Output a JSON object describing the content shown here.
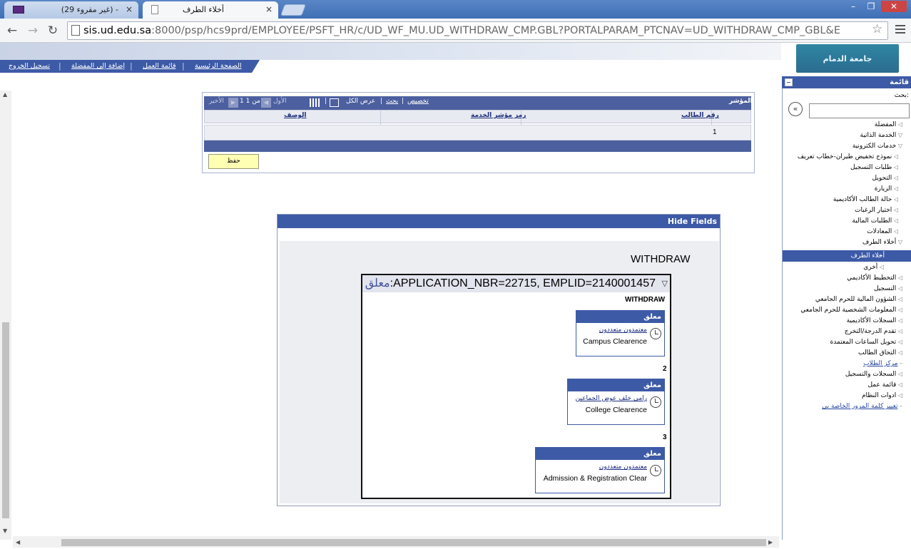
{
  "browser": {
    "tabs": [
      {
        "label": "(29 غير مقروء) -",
        "close": "×"
      },
      {
        "label": "أخلاء الطرف",
        "close": "×"
      }
    ],
    "url_domain": "sis.ud.edu.sa",
    "url_rest": ":8000/psp/hcs9prd/EMPLOYEE/PSFT_HR/c/UD_WF_MU.UD_WITHDRAW_CMP.GBL?PORTALPARAM_PTCNAV=UD_WITHDRAW_CMP_GBL&E",
    "window_buttons": [
      "–",
      "❐",
      "✕"
    ]
  },
  "header": {
    "links": [
      "الصفحة الرئيسية",
      "قائمة العمل",
      "إضافة إلى المفضلة",
      "تسجيل الخروج"
    ],
    "logo_text": "جامعة الدمام"
  },
  "menu": {
    "title": "قائمة",
    "search_label": "بحث:",
    "go": "«",
    "items": [
      {
        "label": "المفضلة",
        "type": "closed"
      },
      {
        "label": "الخدمة الذاتية",
        "type": "open"
      },
      {
        "label": "خدمات الكترونية",
        "type": "open"
      },
      {
        "label": "نموذج تخفيض طيران-خطاب تعريف",
        "type": "closed"
      },
      {
        "label": "طلبات التسجيل",
        "type": "closed"
      },
      {
        "label": "التحويل",
        "type": "closed"
      },
      {
        "label": "الزيارة",
        "type": "closed"
      },
      {
        "label": "حالة الطالب الأكاديمية",
        "type": "closed"
      },
      {
        "label": "اختيار الرغبات",
        "type": "closed"
      },
      {
        "label": "الطلبات المالية",
        "type": "closed"
      },
      {
        "label": "المعادلات",
        "type": "closed"
      },
      {
        "label": "أخلاء الطرف",
        "type": "open"
      },
      {
        "label": "أخلاء الطرف",
        "type": "selected"
      },
      {
        "label": "أخرى",
        "type": "closed"
      },
      {
        "label": "التخطيط الأكاديمي",
        "type": "closed"
      },
      {
        "label": "التسجيل",
        "type": "closed"
      },
      {
        "label": "الشؤون المالية للحرم الجامعي",
        "type": "closed"
      },
      {
        "label": "المعلومات الشخصية للحرم الجامعي",
        "type": "closed"
      },
      {
        "label": "السجلات الأكاديمية",
        "type": "closed"
      },
      {
        "label": "تقدم الدرجة/التخرج",
        "type": "closed"
      },
      {
        "label": "تحويل الساعات المعتمدة",
        "type": "closed"
      },
      {
        "label": "التحاق الطالب",
        "type": "closed"
      },
      {
        "label": "مركز الطلاب",
        "type": "link"
      },
      {
        "label": "السجلات والتسجيل",
        "type": "closed"
      },
      {
        "label": "قائمة عمل",
        "type": "closed"
      },
      {
        "label": "ادوات النظام",
        "type": "closed"
      },
      {
        "label": "تغيير كلمة المرور الخاصة بي",
        "type": "link"
      }
    ]
  },
  "grid": {
    "title": "المؤشر",
    "toolbar": [
      "تخصيص",
      "بحث",
      "عرض الكل"
    ],
    "pager": {
      "first": "الأول",
      "count": "1 من 1",
      "last": "الأخير"
    },
    "columns": [
      "رقم الطالب",
      "رمز مؤشر الخدمة",
      "الوصف"
    ],
    "rows": [
      {
        "num": "1",
        "student": "",
        "code": "",
        "desc": ""
      }
    ],
    "save_label": "حفظ"
  },
  "workflow": {
    "hide_label": "Hide Fields",
    "title": "WITHDRAW",
    "box_key": "APPLICATION_NBR=22715, EMPLID=2140001457",
    "box_status": "معلق",
    "stage_label": "WITHDRAW",
    "steps": [
      {
        "num": "",
        "status": "معلق",
        "who": "معتمدون متعددون",
        "what": "Campus Clearence"
      },
      {
        "num": "2",
        "status": "معلق",
        "who": "رامي خلف عوض الجماعين",
        "what": "College Clearence"
      },
      {
        "num": "3",
        "status": "معلق",
        "who": "معتمدون متعددون",
        "what": "Admission & Registration Clear"
      }
    ]
  }
}
